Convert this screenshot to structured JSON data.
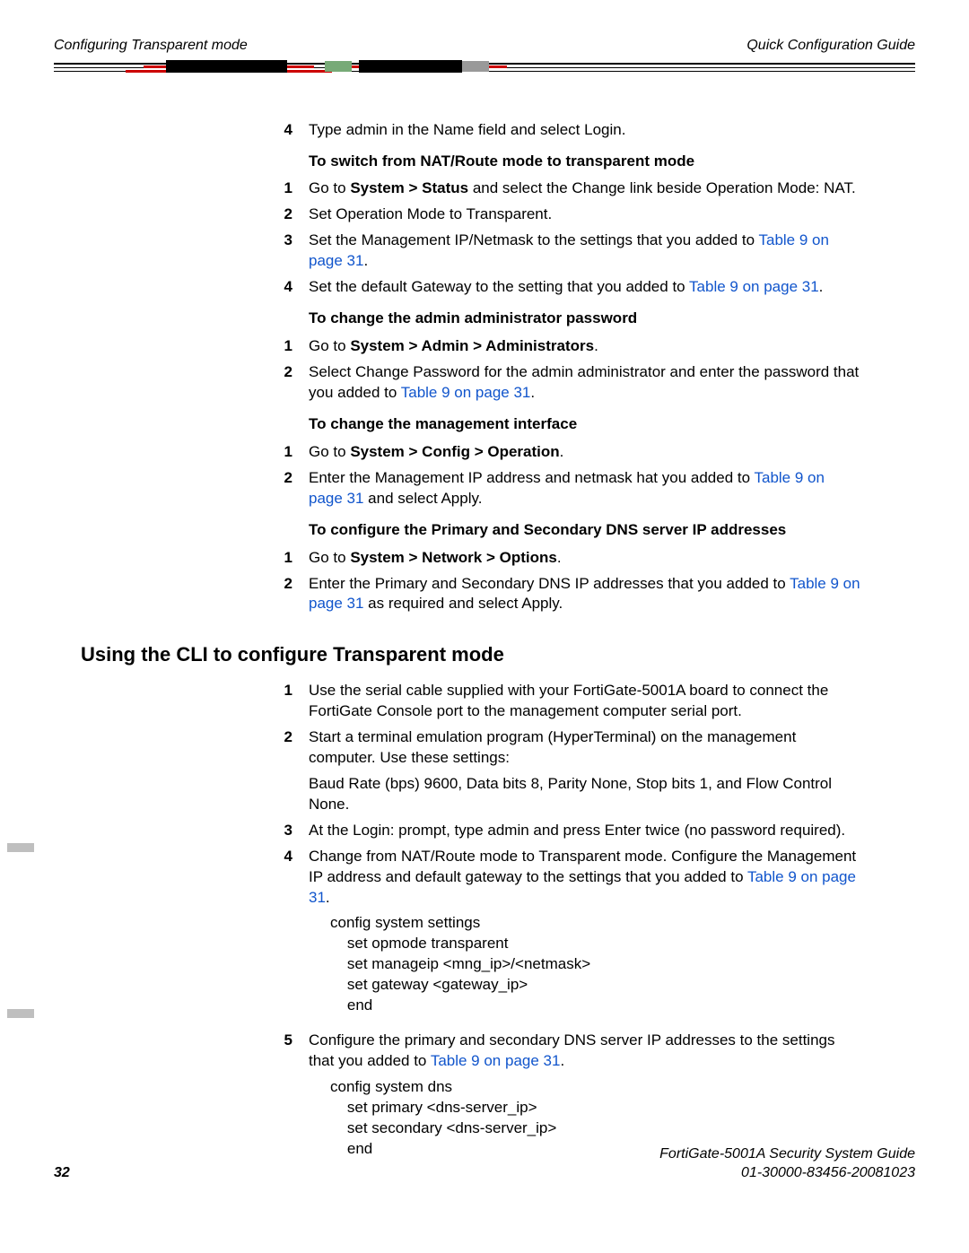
{
  "header": {
    "left": "Configuring Transparent mode",
    "right": "Quick Configuration Guide"
  },
  "step4": "Type admin in the Name field and select Login.",
  "sub1": "To switch from NAT/Route mode to transparent mode",
  "s1_1a": "Go to ",
  "s1_1b": "System > Status",
  "s1_1c": " and select the Change link beside Operation Mode: NAT.",
  "s1_2": "Set Operation Mode to Transparent.",
  "s1_3a": "Set the Management IP/Netmask to the settings that you added to ",
  "s1_3link": "Table 9 on page 31",
  "s1_3b": ".",
  "s1_4a": "Set the default Gateway to the setting that you added to ",
  "s1_4link": "Table 9 on page 31",
  "s1_4b": ".",
  "sub2": "To change the admin administrator password",
  "s2_1a": "Go to ",
  "s2_1b": "System > Admin > Administrators",
  "s2_1c": ".",
  "s2_2a": "Select Change Password for the admin administrator and enter the password that you added to ",
  "s2_2link": "Table 9 on page 31",
  "s2_2b": ".",
  "sub3": "To change the management interface",
  "s3_1a": "Go to ",
  "s3_1b": "System > Config > Operation",
  "s3_1c": ".",
  "s3_2a": "Enter the Management IP address and netmask hat you added to ",
  "s3_2link": "Table 9 on page 31",
  "s3_2b": " and select Apply.",
  "sub4": "To configure the Primary and Secondary DNS server IP addresses",
  "s4_1a": "Go to ",
  "s4_1b": "System > Network > Options",
  "s4_1c": ".",
  "s4_2a": "Enter the Primary and Secondary DNS IP addresses that you added to ",
  "s4_2link": "Table 9 on page 31",
  "s4_2b": " as required and select Apply.",
  "section_heading": "Using the CLI to configure Transparent mode",
  "c1": "Use the serial cable supplied with your FortiGate-5001A board to connect the FortiGate Console port to the management computer serial port.",
  "c2a": "Start a terminal emulation program (HyperTerminal) on the management computer. Use these settings:",
  "c2b": "Baud Rate (bps) 9600, Data bits 8, Parity None, Stop bits 1, and Flow Control None.",
  "c3": "At the Login: prompt, type admin and press Enter twice (no password required).",
  "c4a": "Change from NAT/Route mode to Transparent mode. Configure the Management IP address and default gateway to the settings that you added to ",
  "c4link": "Table 9 on page 31",
  "c4b": ".",
  "code1": "config system settings\n    set opmode transparent\n    set manageip <mng_ip>/<netmask>\n    set gateway <gateway_ip>\n    end",
  "c5a": "Configure the primary and secondary DNS server IP addresses to the settings that you added to ",
  "c5link": "Table 9 on page 31",
  "c5b": ".",
  "code2": "config system dns\n    set primary <dns-server_ip>\n    set secondary <dns-server_ip>\n    end",
  "footer": {
    "page": "32",
    "line1": "FortiGate-5001A   Security System Guide",
    "line2": "01-30000-83456-20081023"
  }
}
